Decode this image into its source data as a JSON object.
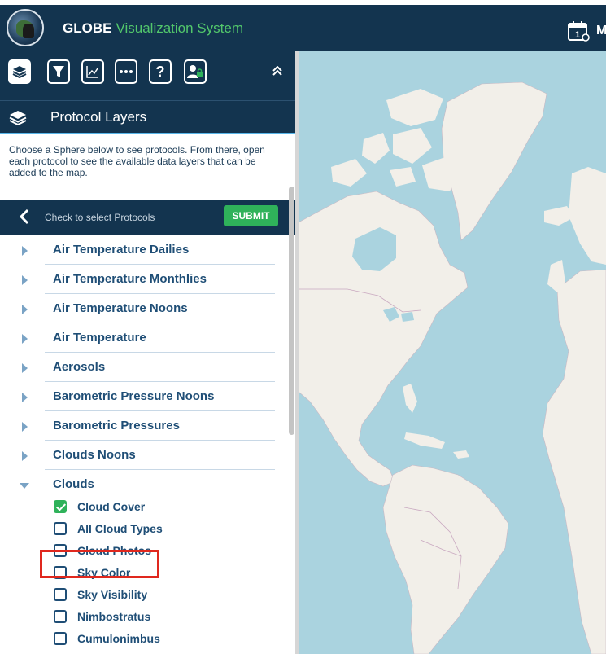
{
  "header": {
    "brand": "GLOBE",
    "brand_sub": "Visualization System",
    "right_letter": "M"
  },
  "toolbar": {
    "buttons": [
      "layers-icon",
      "filter-icon",
      "chart-icon",
      "more-icon",
      "help-icon",
      "user-icon"
    ]
  },
  "section": {
    "title": "Protocol Layers",
    "description": "Choose a Sphere below to see protocols. From there, open each protocol to see the available data layers that can be added to the map."
  },
  "protocol_bar": {
    "hint": "Check to select Protocols",
    "submit_label": "SUBMIT"
  },
  "protocols": [
    "Air Temperature Dailies",
    "Air Temperature Monthlies",
    "Air Temperature Noons",
    "Air Temperature",
    "Aerosols",
    "Barometric Pressure Noons",
    "Barometric Pressures",
    "Clouds Noons",
    "Clouds"
  ],
  "cloud_layers": [
    {
      "label": "Cloud Cover",
      "checked": true
    },
    {
      "label": "All Cloud Types",
      "checked": false
    },
    {
      "label": "Cloud Photos",
      "checked": false
    },
    {
      "label": "Sky Color",
      "checked": false
    },
    {
      "label": "Sky Visibility",
      "checked": false
    },
    {
      "label": "Nimbostratus",
      "checked": false
    },
    {
      "label": "Cumulonimbus",
      "checked": false
    }
  ],
  "colors": {
    "header_bg": "#13344f",
    "accent_green": "#2fb25a",
    "link_blue": "#1f4e76",
    "ocean": "#aad3df",
    "land": "#f2efe9",
    "highlight": "#e0281e"
  }
}
